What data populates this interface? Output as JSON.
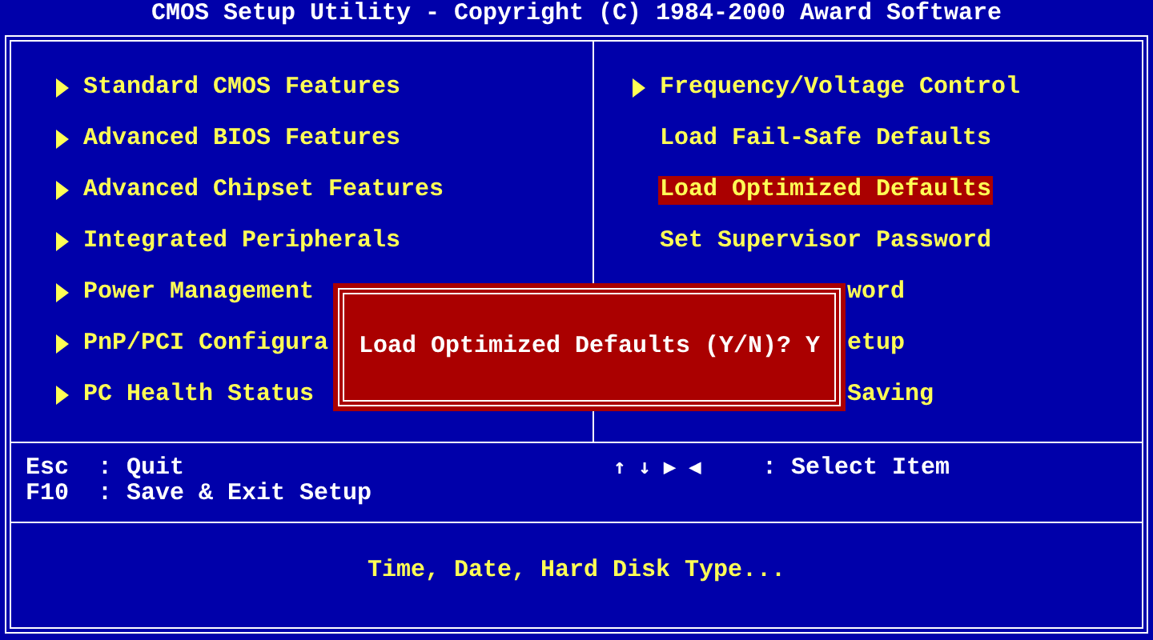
{
  "title": "CMOS Setup Utility - Copyright (C) 1984-2000 Award Software",
  "left_menu": [
    {
      "label": "Standard CMOS Features",
      "submenu": true,
      "selected": false,
      "covered": false
    },
    {
      "label": "Advanced BIOS Features",
      "submenu": true,
      "selected": false,
      "covered": false
    },
    {
      "label": "Advanced Chipset Features",
      "submenu": true,
      "selected": false,
      "covered": false
    },
    {
      "label": "Integrated Peripherals",
      "submenu": true,
      "selected": false,
      "covered": false
    },
    {
      "label": "Power Management",
      "submenu": true,
      "selected": false,
      "covered": false
    },
    {
      "label": "PnP/PCI Configura",
      "submenu": true,
      "selected": false,
      "covered": false
    },
    {
      "label": "PC Health Status",
      "submenu": true,
      "selected": false,
      "covered": false
    }
  ],
  "right_menu": [
    {
      "label": "Frequency/Voltage Control",
      "submenu": true,
      "selected": false,
      "covered": false
    },
    {
      "label": "Load Fail-Safe Defaults",
      "submenu": false,
      "selected": false,
      "covered": false
    },
    {
      "label": "Load Optimized Defaults",
      "submenu": false,
      "selected": true,
      "covered": false
    },
    {
      "label": "Set Supervisor Password",
      "submenu": false,
      "selected": false,
      "covered": false
    },
    {
      "label": "word",
      "submenu": false,
      "selected": false,
      "covered": true
    },
    {
      "label": "etup",
      "submenu": false,
      "selected": false,
      "covered": true
    },
    {
      "label": "Saving",
      "submenu": false,
      "selected": false,
      "covered": true
    }
  ],
  "help_left": [
    {
      "key": "Esc",
      "desc": ": Quit"
    },
    {
      "key": "F10",
      "desc": ": Save & Exit Setup"
    }
  ],
  "help_right": [
    {
      "key": "↑ ↓ ▶ ◀",
      "desc": ": Select Item"
    }
  ],
  "description": "Time, Date, Hard Disk Type...",
  "dialog": {
    "prompt": "Load Optimized Defaults (Y/N)? Y"
  }
}
